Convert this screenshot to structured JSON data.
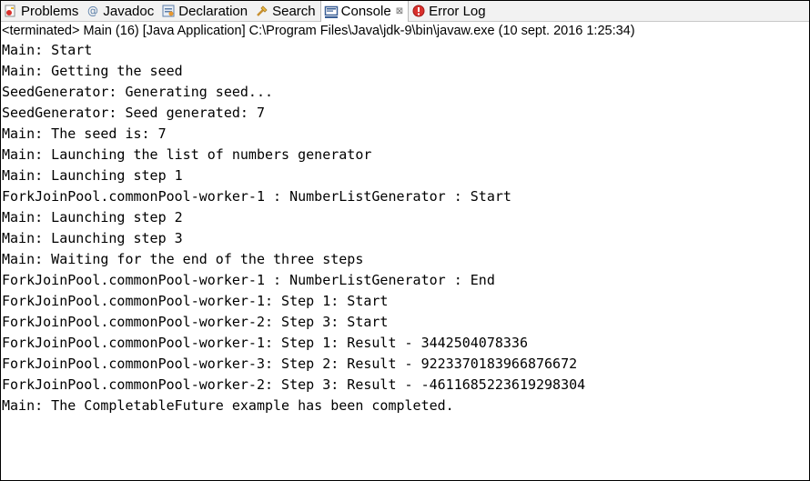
{
  "tabs": [
    {
      "label": "Problems",
      "icon": "problems-icon"
    },
    {
      "label": "Javadoc",
      "icon": "javadoc-icon"
    },
    {
      "label": "Declaration",
      "icon": "declaration-icon"
    },
    {
      "label": "Search",
      "icon": "search-icon"
    },
    {
      "label": "Console",
      "icon": "console-icon",
      "close": "⊠"
    },
    {
      "label": "Error Log",
      "icon": "error-log-icon"
    }
  ],
  "status": "<terminated> Main (16) [Java Application] C:\\Program Files\\Java\\jdk-9\\bin\\javaw.exe (10 sept. 2016 1:25:34)",
  "console": {
    "lines": [
      "Main: Start",
      "Main: Getting the seed",
      "SeedGenerator: Generating seed...",
      "SeedGenerator: Seed generated: 7",
      "Main: The seed is: 7",
      "Main: Launching the list of numbers generator",
      "Main: Launching step 1",
      "ForkJoinPool.commonPool-worker-1 : NumberListGenerator : Start",
      "Main: Launching step 2",
      "Main: Launching step 3",
      "Main: Waiting for the end of the three steps",
      "ForkJoinPool.commonPool-worker-1 : NumberListGenerator : End",
      "ForkJoinPool.commonPool-worker-1: Step 1: Start",
      "ForkJoinPool.commonPool-worker-2: Step 3: Start",
      "ForkJoinPool.commonPool-worker-1: Step 1: Result - 3442504078336",
      "ForkJoinPool.commonPool-worker-3: Step 2: Result - 9223370183966876672",
      "ForkJoinPool.commonPool-worker-2: Step 3: Result - -4611685223619298304",
      "Main: The CompletableFuture example has been completed."
    ]
  }
}
